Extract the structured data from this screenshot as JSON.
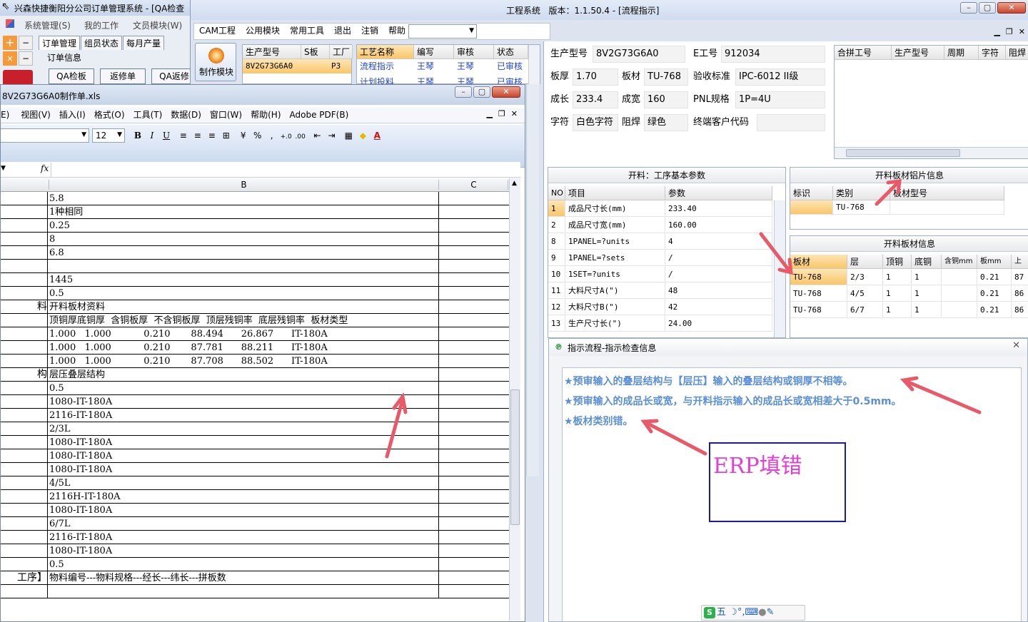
{
  "oms": {
    "title": "兴森快捷衡阳分公司订单管理系统 - [QA检查",
    "menu": [
      "系统管理(S)",
      "我的工作",
      "文员模块(W)"
    ],
    "tabs": [
      "订单管理",
      "组员状态",
      "每月产量"
    ],
    "section_label": "订单信息",
    "buttons": [
      "QA检板",
      "返修单",
      "QA返修"
    ]
  },
  "eng": {
    "title": "工程系统   版本：1.1.50.4 - [流程指示]",
    "menu": [
      "CAM工程",
      "公用模块",
      "常用工具",
      "退出",
      "注销",
      "帮助"
    ],
    "make_module": "制作模块",
    "list1": {
      "headers": [
        "生产型号",
        "S板",
        "工厂"
      ],
      "row": [
        "8V2G73G6A0",
        "",
        "P3"
      ]
    },
    "list2": {
      "headers": [
        "工艺名称",
        "编写",
        "审核",
        "状态"
      ],
      "rows": [
        [
          "流程指示",
          "王琴",
          "王琴",
          "已审核"
        ],
        [
          "计划投料",
          "王琴",
          "王琴",
          "已审核"
        ]
      ]
    },
    "fields": {
      "prod_model_label": "生产型号",
      "prod_model": "8V2G73G6A0",
      "e_no_label": "E工号",
      "e_no": "912034",
      "thickness_label": "板厚",
      "thickness": "1.70",
      "material_label": "板材",
      "material": "TU-768",
      "std_label": "验收标准",
      "std": "IPC-6012 II级",
      "length_label": "成长",
      "length": "233.4",
      "width_label": "成宽",
      "width": "160",
      "pnl_label": "PNL规格",
      "pnl": "1P=4U",
      "charset_label": "字符",
      "charset": "白色字符",
      "mask_label": "阻焊",
      "mask": "绿色",
      "customer_label": "终端客户代码",
      "customer": ""
    },
    "merge_table": {
      "headers": [
        "合拼工号",
        "生产型号",
        "周期",
        "字符",
        "阻焊"
      ]
    },
    "basic_params": {
      "title": "开料：工序基本参数",
      "headers": [
        "NO",
        "项目",
        "参数"
      ],
      "rows": [
        [
          "1",
          "成品尺寸长(mm)",
          "233.40"
        ],
        [
          "2",
          "成品尺寸宽(mm)",
          "160.00"
        ],
        [
          "8",
          "1PANEL=?units",
          "4"
        ],
        [
          "9",
          "1PANEL=?sets",
          "/"
        ],
        [
          "10",
          "1SET=?units",
          "/"
        ],
        [
          "11",
          "大料尺寸A(\")",
          "48"
        ],
        [
          "12",
          "大料尺寸B(\")",
          "42"
        ],
        [
          "13",
          "生产尺寸长(\")",
          "24.00"
        ]
      ]
    },
    "sheet_info": {
      "title": "开料板材铝片信息",
      "headers": [
        "标识",
        "类别",
        "板材型号"
      ],
      "row": [
        "",
        "TU-768",
        ""
      ]
    },
    "material_info": {
      "title": "开料板材信息",
      "headers": [
        "板材",
        "层",
        "顶铜",
        "底铜",
        "含铜mm",
        "板mm",
        "上"
      ],
      "rows": [
        [
          "TU-768",
          "2/3",
          "1",
          "1",
          "",
          "0.21",
          "87"
        ],
        [
          "TU-768",
          "4/5",
          "1",
          "1",
          "",
          "0.21",
          "86"
        ],
        [
          "TU-768",
          "6/7",
          "1",
          "1",
          "",
          "0.21",
          "86"
        ]
      ]
    }
  },
  "excel": {
    "title": "8V2G73G6A0制作单.xls",
    "menu": [
      "E)",
      "视图(V)",
      "插入(I)",
      "格式(O)",
      "工具(T)",
      "数据(D)",
      "窗口(W)",
      "帮助(H)",
      "Adobe PDF(B)"
    ],
    "font_size": "12",
    "fx_label": "fx",
    "col_headers": [
      "B",
      "C"
    ],
    "rows": [
      [
        "",
        "5.8"
      ],
      [
        "",
        "1种相同"
      ],
      [
        "",
        "0.25"
      ],
      [
        "",
        "8"
      ],
      [
        "",
        "6.8"
      ],
      [
        "",
        ""
      ],
      [
        "",
        "1445"
      ],
      [
        "",
        "0.5"
      ],
      [
        "料",
        "开料板材资料"
      ],
      [
        "",
        "顶铜厚底铜厚  含铜板厚  不含铜板厚  顶层残铜率  底层残铜率  板材类型"
      ],
      [
        "",
        "1.000   1.000           0.210       88.494      26.867      IT-180A"
      ],
      [
        "",
        "1.000   1.000           0.210       87.781      88.211      IT-180A"
      ],
      [
        "",
        "1.000   1.000           0.210       87.708      88.502      IT-180A"
      ],
      [
        "构",
        "层压叠层结构"
      ],
      [
        "",
        "0.5"
      ],
      [
        "",
        "1080-IT-180A"
      ],
      [
        "",
        "2116-IT-180A"
      ],
      [
        "",
        "2/3L"
      ],
      [
        "",
        "1080-IT-180A"
      ],
      [
        "",
        "1080-IT-180A"
      ],
      [
        "",
        "1080-IT-180A"
      ],
      [
        "",
        "4/5L"
      ],
      [
        "",
        "2116H-IT-180A"
      ],
      [
        "",
        "1080-IT-180A"
      ],
      [
        "",
        "6/7L"
      ],
      [
        "",
        "2116-IT-180A"
      ],
      [
        "",
        "1080-IT-180A"
      ],
      [
        "",
        "0.5"
      ],
      [
        "工序】",
        "物料编号---物料规格---经长---纬长---拼板数"
      ],
      [
        "",
        ""
      ]
    ]
  },
  "dialog": {
    "title": "指示流程-指示检查信息",
    "messages": [
      "★预审输入的叠层结构与【层压】输入的叠层结构或铜厚不相等。",
      "★预审输入的成品长或宽，与开料指示输入的成品长或宽相差大于0.5mm。",
      "★板材类别错。"
    ],
    "annotation": "ERP填错"
  },
  "ime": {
    "mode": "五"
  },
  "colors": {
    "message_blue": "#5b8fd6",
    "annotation_magenta": "#e43fd4",
    "arrow_red": "#e85a6a",
    "selection_orange": "#f9c66a"
  }
}
